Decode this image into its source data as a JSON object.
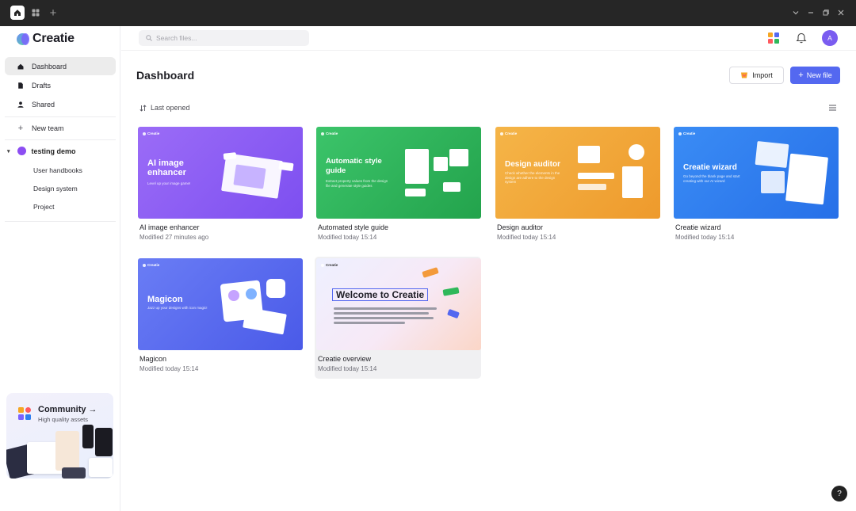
{
  "app": {
    "name": "Creatie"
  },
  "sidebar": {
    "nav": [
      {
        "label": "Dashboard"
      },
      {
        "label": "Drafts"
      },
      {
        "label": "Shared"
      }
    ],
    "new_team": "New team",
    "team": {
      "name": "testing demo",
      "projects": [
        "User handbooks",
        "Design system",
        "Project"
      ]
    },
    "community": {
      "title": "Community →",
      "subtitle": "High quality assets"
    }
  },
  "header": {
    "search_placeholder": "Search files...",
    "avatar_initial": "A"
  },
  "main": {
    "title": "Dashboard",
    "import_label": "Import",
    "new_file_label": "New file",
    "sort_label": "Last opened",
    "files": [
      {
        "name": "AI image enhancer",
        "modified": "Modified 27 minutes ago",
        "thumb_title": "AI image enhancer",
        "thumb_sub": "Level up your image game!",
        "thumb_brand": "Creatie"
      },
      {
        "name": "Automated style guide",
        "modified": "Modified today 15:14",
        "thumb_title": "Automatic style guide",
        "thumb_sub": "Extract property values from the design file and generate style guides",
        "thumb_brand": "Creatie"
      },
      {
        "name": "Design auditor",
        "modified": "Modified today 15:14",
        "thumb_title": "Design auditor",
        "thumb_sub": "Check whether the elements in the design are adhere to the design system",
        "thumb_brand": "Creatie"
      },
      {
        "name": "Creatie wizard",
        "modified": "Modified today 15:14",
        "thumb_title": "Creatie wizard",
        "thumb_sub": "Go beyond the blank page and start creating with our AI wizard",
        "thumb_brand": "Creatie"
      },
      {
        "name": "Magicon",
        "modified": "Modified today 15:14",
        "thumb_title": "Magicon",
        "thumb_sub": "Jazz up your designs with icon magic!",
        "thumb_brand": "Creatie"
      },
      {
        "name": "Creatie overview",
        "modified": "Modified today 15:14",
        "thumb_title": "Welcome to Creatie",
        "thumb_brand": "Creatie"
      }
    ]
  },
  "colors": {
    "accent": "#5468f0",
    "purple_card": "#8b5cf6",
    "green_card": "#2fb85a",
    "orange_card": "#f2a93b",
    "blue_card": "#2f7ef0",
    "indigo_card": "#5b6cf0"
  },
  "help_label": "?"
}
